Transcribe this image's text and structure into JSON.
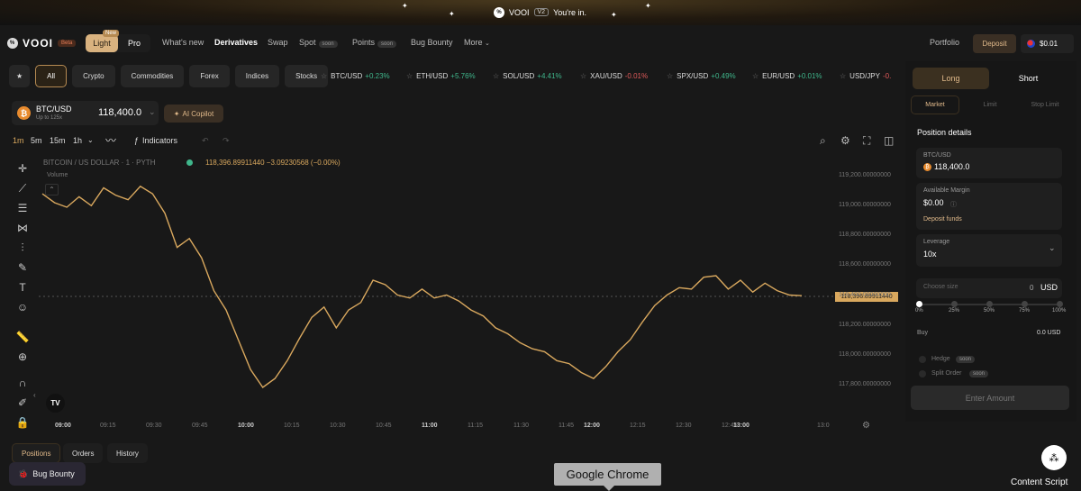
{
  "banner": {
    "brand": "VOOI",
    "version": "V2",
    "message": "You're in."
  },
  "nav": {
    "logo": "VOOI",
    "beta": "Beta",
    "mode_light": "Light",
    "mode_pro": "Pro",
    "new_tag": "New",
    "items": [
      {
        "label": "What's new"
      },
      {
        "label": "Derivatives"
      },
      {
        "label": "Swap"
      },
      {
        "label": "Spot",
        "soon": "soon"
      },
      {
        "label": "Points",
        "soon": "soon"
      },
      {
        "label": "Bug Bounty"
      },
      {
        "label": "More"
      }
    ],
    "portfolio": "Portfolio",
    "deposit": "Deposit",
    "balance": "$0.01"
  },
  "filters": [
    "All",
    "Crypto",
    "Commodities",
    "Forex",
    "Indices",
    "Stocks"
  ],
  "tickers": [
    {
      "pair": "BTC/USD",
      "change": "+0.23%",
      "dir": "up"
    },
    {
      "pair": "ETH/USD",
      "change": "+5.76%",
      "dir": "up"
    },
    {
      "pair": "SOL/USD",
      "change": "+4.41%",
      "dir": "up"
    },
    {
      "pair": "XAU/USD",
      "change": "-0.01%",
      "dir": "dn"
    },
    {
      "pair": "SPX/USD",
      "change": "+0.49%",
      "dir": "up"
    },
    {
      "pair": "EUR/USD",
      "change": "+0.01%",
      "dir": "up"
    },
    {
      "pair": "USD/JPY",
      "change": "-0.",
      "dir": "dn"
    }
  ],
  "pair": {
    "name": "BTC/USD",
    "sub": "Up to 125x",
    "price": "118,400.0",
    "coin": "₿"
  },
  "ai_copilot": "AI Copilot",
  "timeframes": [
    "1m",
    "5m",
    "15m",
    "1h"
  ],
  "indicators": "Indicators",
  "chart_header": {
    "title": "BITCOIN / US DOLLAR · 1 · PYTH",
    "value": "118,396.89911440 −3.09230568 (−0.00%)",
    "volume": "Volume"
  },
  "price_tag": "118,396.89911440",
  "bottom_tabs": [
    "Positions",
    "Orders",
    "History"
  ],
  "bug_bounty": "Bug Bounty",
  "tooltip": "Google Chrome",
  "content_script": "Content Script",
  "trade": {
    "long": "Long",
    "short": "Short",
    "order_types": [
      "Market",
      "Limit",
      "Stop Limit"
    ],
    "position_details": "Position details",
    "asset_label": "BTC/USD",
    "asset_price": "118,400.0",
    "margin_label": "Available Margin",
    "margin_value": "$0.00",
    "deposit_funds": "Deposit funds",
    "leverage_label": "Leverage",
    "leverage_value": "10x",
    "size_placeholder": "Choose size",
    "size_value": "0",
    "size_unit": "USD",
    "pcts": [
      "0%",
      "25%",
      "50%",
      "75%",
      "100%"
    ],
    "buy_label": "Buy",
    "buy_value": "0.0 USD",
    "hedge": "Hedge",
    "split_order": "Split Order",
    "soon": "soon",
    "enter_amount": "Enter Amount"
  },
  "chart_data": {
    "type": "line",
    "yticks": [
      "119,200.00000000",
      "119,000.00000000",
      "118,800.00000000",
      "118,600.00000000",
      "118,400.00000000",
      "118,200.00000000",
      "118,000.00000000",
      "117,800.00000000"
    ],
    "xticks": [
      "09:00",
      "09:15",
      "09:30",
      "09:45",
      "10:00",
      "10:15",
      "10:30",
      "10:45",
      "11:00",
      "11:15",
      "11:30",
      "11:45",
      "12:00",
      "12:15",
      "12:30",
      "12:45",
      "13:00",
      "13:0"
    ],
    "ylim": [
      117750,
      119250
    ],
    "values": [
      119080,
      119020,
      118990,
      119060,
      119000,
      119120,
      119070,
      119040,
      119130,
      119080,
      118950,
      118720,
      118780,
      118650,
      118430,
      118300,
      118100,
      117900,
      117780,
      117840,
      117960,
      118110,
      118250,
      118320,
      118180,
      118300,
      118350,
      118500,
      118470,
      118400,
      118380,
      118440,
      118380,
      118400,
      118360,
      118300,
      118260,
      118180,
      118140,
      118080,
      118040,
      118020,
      117960,
      117940,
      117880,
      117840,
      117920,
      118020,
      118100,
      118220,
      118330,
      118400,
      118450,
      118440,
      118520,
      118530,
      118440,
      118500,
      118420,
      118480,
      118430,
      118400,
      118396
    ]
  },
  "colors": {
    "accent": "#d9a85e",
    "up": "#3fb68b",
    "down": "#e05a5a"
  }
}
